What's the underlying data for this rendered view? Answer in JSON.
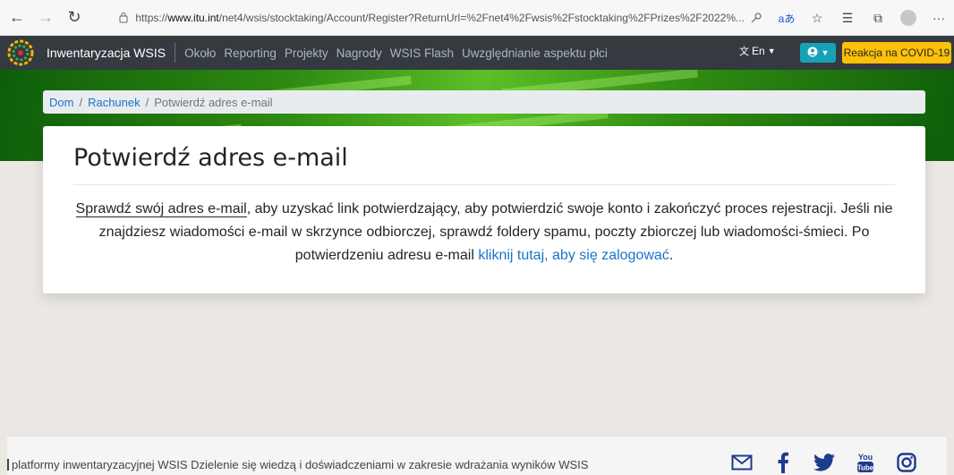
{
  "browser": {
    "url_prefix": "https://",
    "url_host": "www.itu.int",
    "url_path": "/net4/wsis/stocktaking/Account/Register?ReturnUrl=%2Fnet4%2Fwsis%2Fstocktaking%2FPrizes%2F2022%...",
    "translate_label": "aあ"
  },
  "navbar": {
    "brand": "Inwentaryzacja WSIS",
    "links": [
      "Około",
      "Reporting",
      "Projekty",
      "Nagrody",
      "WSIS Flash",
      "Uwzględnianie aspektu płci"
    ],
    "lang": "En",
    "covid_button": "Reakcja na COVID-19"
  },
  "breadcrumb": {
    "home": "Dom",
    "account": "Rachunek",
    "current": "Potwierdź adres e-mail"
  },
  "card": {
    "title": "Potwierdź adres e-mail",
    "msg_underlined": "Sprawdź swój adres e-mail",
    "msg_part1": ", aby uzyskać link potwierdzający, aby potwierdzić swoje konto i zakończyć proces rejestracji. Jeśli nie znajdziesz wiadomości e-mail w skrzynce odbiorczej, sprawdź foldery spamu, poczty zbiorczej lub wiadomości-śmieci. Po potwierdzeniu adresu e-mail ",
    "msg_link": "kliknij tutaj, aby się zalogować",
    "msg_end": "."
  },
  "footer": {
    "text": "platformy inwentaryzacyjnej WSIS Dzielenie się wiedzą i doświadczeniami w zakresie wdrażania wyników WSIS",
    "social": [
      "email-icon",
      "facebook-icon",
      "twitter-icon",
      "youtube-icon",
      "instagram-icon"
    ]
  },
  "colors": {
    "navbar": "#343a40",
    "link": "#1a73c8",
    "covid": "#ffc107",
    "user_button": "#17a2b8",
    "social": "#1f3b8f"
  }
}
